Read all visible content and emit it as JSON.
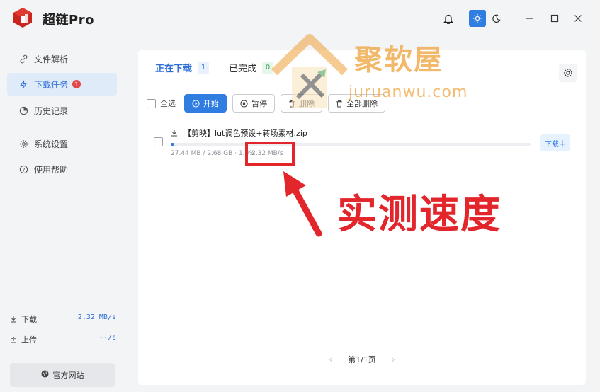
{
  "app": {
    "title": "超链Pro"
  },
  "sidebar": {
    "items": [
      {
        "label": "文件解析",
        "icon": "link-icon"
      },
      {
        "label": "下载任务",
        "icon": "lightning-icon",
        "badge": "1"
      },
      {
        "label": "历史记录",
        "icon": "history-icon"
      },
      {
        "label": "系统设置",
        "icon": "gear-icon"
      },
      {
        "label": "使用帮助",
        "icon": "help-icon"
      }
    ],
    "download": {
      "label": "下载",
      "value": "2.32 MB/s"
    },
    "upload": {
      "label": "上传",
      "value": "--/s"
    },
    "site_button": "官方网站"
  },
  "tabs": [
    {
      "label": "正在下载",
      "count": "1"
    },
    {
      "label": "已完成",
      "count": "0"
    }
  ],
  "toolbar": {
    "select_all": "全选",
    "start": "开始",
    "pause": "暂停",
    "delete": "删除",
    "delete_all": "全部删除"
  },
  "task": {
    "name": "【剪映】lut调色预设+转场素材.zip",
    "progress": 0.01,
    "size_info": "27.44 MB / 2.68 GB · 1.0%",
    "speed": "2.32 MB/s",
    "status": "下载中"
  },
  "pager": {
    "text": "第1/1页"
  },
  "watermark": {
    "title": "聚软屋",
    "domain": "juruanwu.com"
  },
  "annotation": {
    "callout": "实测速度"
  },
  "colors": {
    "accent": "#2f7de1",
    "annotation": "#e3262c",
    "watermark": "#f0a23a",
    "badge": "#e24a4a"
  }
}
